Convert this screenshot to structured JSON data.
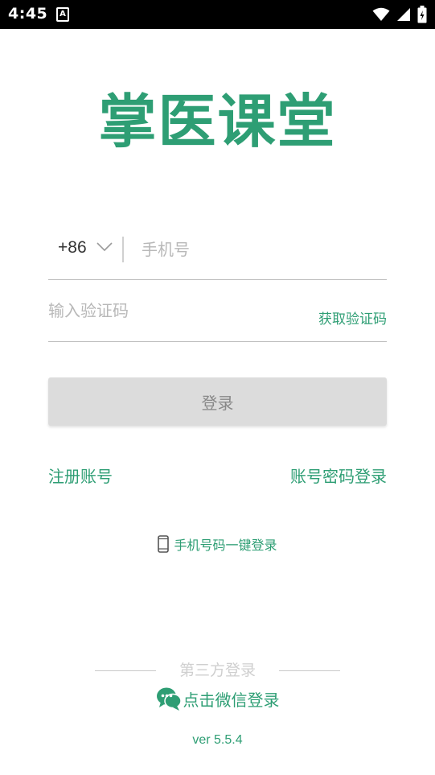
{
  "status_bar": {
    "time": "4:45",
    "notification_icon": "A",
    "icons": [
      "wifi-icon",
      "signal-icon",
      "battery-icon"
    ]
  },
  "app": {
    "logo_text": "掌医课堂",
    "brand_color": "#2e9e74"
  },
  "phone": {
    "country_code": "+86",
    "placeholder": "手机号",
    "value": ""
  },
  "code": {
    "placeholder": "输入验证码",
    "value": "",
    "get_code_label": "获取验证码"
  },
  "login_button": {
    "label": "登录",
    "enabled": false
  },
  "links": {
    "register": "注册账号",
    "password_login": "账号密码登录",
    "one_key_login": "手机号码一键登录"
  },
  "third_party": {
    "title": "第三方登录",
    "wechat_label": "点击微信登录"
  },
  "version": "ver 5.5.4"
}
